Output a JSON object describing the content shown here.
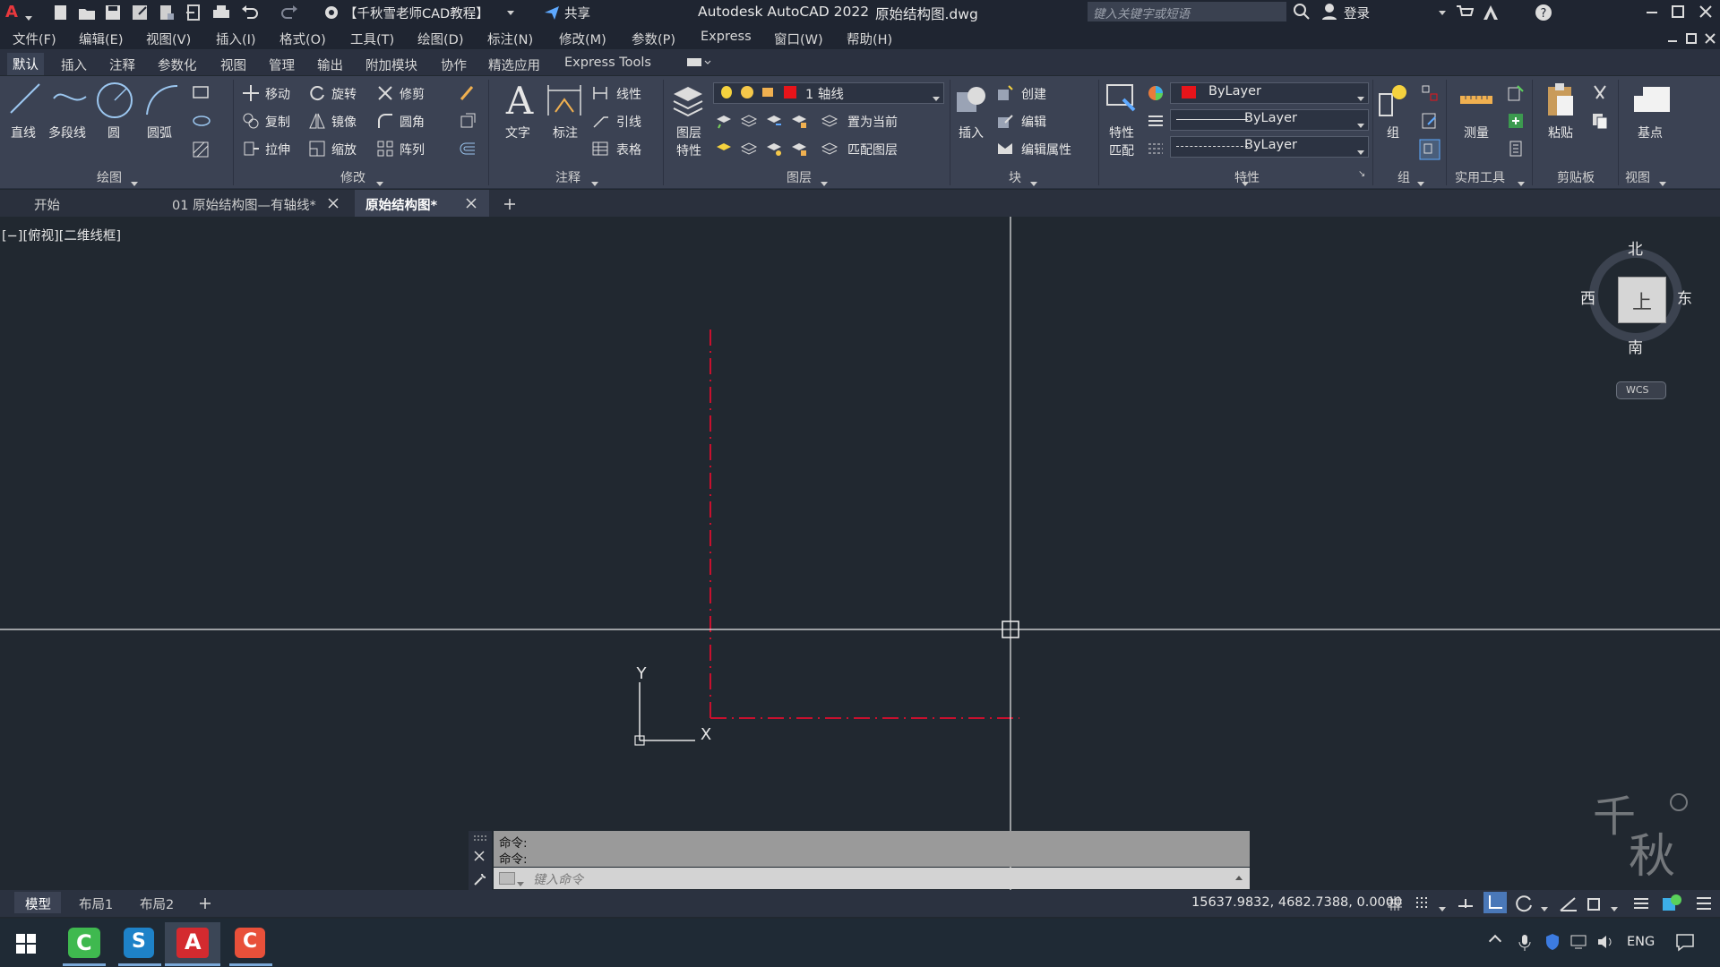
{
  "titlebar": {
    "app_title": "Autodesk AutoCAD 2022",
    "file_name": "原始结构图.dwg",
    "workspace": "【千秋雪老师CAD教程】",
    "share": "共享",
    "search_placeholder": "键入关键字或短语",
    "login": "登录"
  },
  "menu": [
    "文件(F)",
    "编辑(E)",
    "视图(V)",
    "插入(I)",
    "格式(O)",
    "工具(T)",
    "绘图(D)",
    "标注(N)",
    "修改(M)",
    "参数(P)",
    "Express",
    "窗口(W)",
    "帮助(H)"
  ],
  "ribbon_tabs": [
    "默认",
    "插入",
    "注释",
    "参数化",
    "视图",
    "管理",
    "输出",
    "附加模块",
    "协作",
    "精选应用",
    "Express Tools"
  ],
  "ribbon": {
    "draw": {
      "line": "直线",
      "polyline": "多段线",
      "circle": "圆",
      "arc": "圆弧",
      "title": "绘图"
    },
    "modify": {
      "move": "移动",
      "rotate": "旋转",
      "trim": "修剪",
      "copy": "复制",
      "mirror": "镜像",
      "fillet": "圆角",
      "stretch": "拉伸",
      "scale": "缩放",
      "array": "阵列",
      "title": "修改"
    },
    "annotation": {
      "text": "文字",
      "dimension": "标注",
      "linear": "线性",
      "leader": "引线",
      "table": "表格",
      "title": "注释"
    },
    "layers": {
      "layer_props": "图层",
      "layer_props2": "特性",
      "current_layer": "1 轴线",
      "make_current": "置为当前",
      "match_layer": "匹配图层",
      "title": "图层"
    },
    "block": {
      "insert": "插入",
      "create": "创建",
      "edit": "编辑",
      "edit_attr": "编辑属性",
      "title": "块"
    },
    "properties": {
      "match": "特性",
      "match2": "匹配",
      "color": "ByLayer",
      "lineweight": "ByLayer",
      "linetype": "ByLayer",
      "title": "特性"
    },
    "groups": {
      "group": "组",
      "title": "组"
    },
    "utilities": {
      "measure": "测量",
      "title": "实用工具"
    },
    "clipboard": {
      "paste": "粘贴",
      "title": "剪贴板"
    },
    "view": {
      "base": "基点",
      "title": "视图"
    }
  },
  "doc_tabs": [
    "开始",
    "01 原始结构图—有轴线*",
    "原始结构图*"
  ],
  "viewport_label": "[−][俯视][二维线框]",
  "viewcube": {
    "north": "北",
    "south": "南",
    "east": "东",
    "west": "西",
    "top": "上",
    "wcs": "WCS"
  },
  "ucs": {
    "x": "X",
    "y": "Y"
  },
  "command": {
    "history": [
      "命令:",
      "命令:"
    ],
    "placeholder": "键入命令"
  },
  "layout_tabs": [
    "模型",
    "布局1",
    "布局2"
  ],
  "coordinates": "15637.9832, 4682.7388, 0.0000",
  "tray": {
    "lang": "ENG"
  },
  "colors": {
    "axis_line": "#c8102e",
    "layer_color": "#e8141a",
    "background": "#212830"
  }
}
